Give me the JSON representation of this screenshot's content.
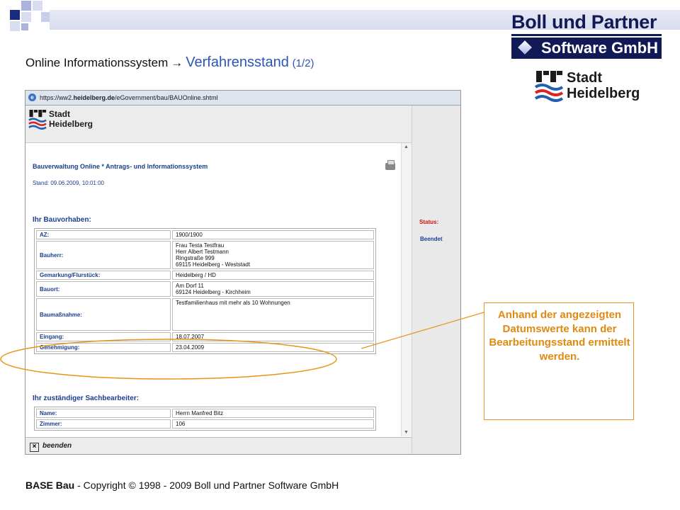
{
  "colors": {
    "accent_blue": "#2b55b8",
    "navy": "#111a55",
    "callout_orange": "#e08a10",
    "status_red": "#cc1111"
  },
  "brand": {
    "line1": "Boll und Partner",
    "line2": "Software GmbH"
  },
  "city_logo": {
    "line1": "Stadt",
    "line2": "Heidelberg"
  },
  "title": {
    "main": "Online Informationssystem",
    "arrow_icon": "right-arrow",
    "sub": "Verfahrensstand",
    "page": "(1/2)"
  },
  "browser": {
    "url_prefix": "https://ww2.",
    "url_domain": "heidelberg.de",
    "url_path": "/eGovernment/bau/BAUOnline.shtml",
    "page_title": "Bauverwaltung Online * Antrags- und Informationssystem",
    "stand": "Stand: 09.06.2009, 10:01:00",
    "section1": "Ihr Bauvorhaben:",
    "section2": "Ihr zuständiger Sachbearbeiter:",
    "status_label": "Status:",
    "status_value": "Beendet",
    "close_label": "beenden",
    "rows": [
      {
        "label": "AZ:",
        "value": [
          "1900/1900"
        ]
      },
      {
        "label": "Bauherr:",
        "value": [
          "Frau Testa Testfrau",
          "Herr Albert Testmann",
          "Ringstraße 999",
          "69115 Heidelberg - Weststadt"
        ]
      },
      {
        "label": "Gemarkung/Flurstück:",
        "value": [
          "Heidelberg / HD"
        ]
      },
      {
        "label": "Bauort:",
        "value": [
          "Am Dorf 11",
          "69124 Heidelberg - Kirchheim"
        ]
      },
      {
        "label": "Baumaßnahme:",
        "value": [
          "Testfamilienhaus mit mehr als 10 Wohnungen"
        ]
      },
      {
        "label": "Eingang:",
        "value": [
          "18.07.2007"
        ]
      },
      {
        "label": "Genehmigung:",
        "value": [
          "23.04.2009"
        ]
      }
    ],
    "rows2": [
      {
        "label": "Name:",
        "value": [
          "Herrn Manfred Bitz"
        ]
      },
      {
        "label": "Zimmer:",
        "value": [
          "106"
        ]
      }
    ]
  },
  "callout": "Anhand der angezeigten Datumswerte kann der Bearbeitungsstand ermittelt werden.",
  "footer": {
    "bold": "BASE Bau",
    "rest": " - Copyright © 1998 -  2009 Boll und Partner Software GmbH"
  }
}
